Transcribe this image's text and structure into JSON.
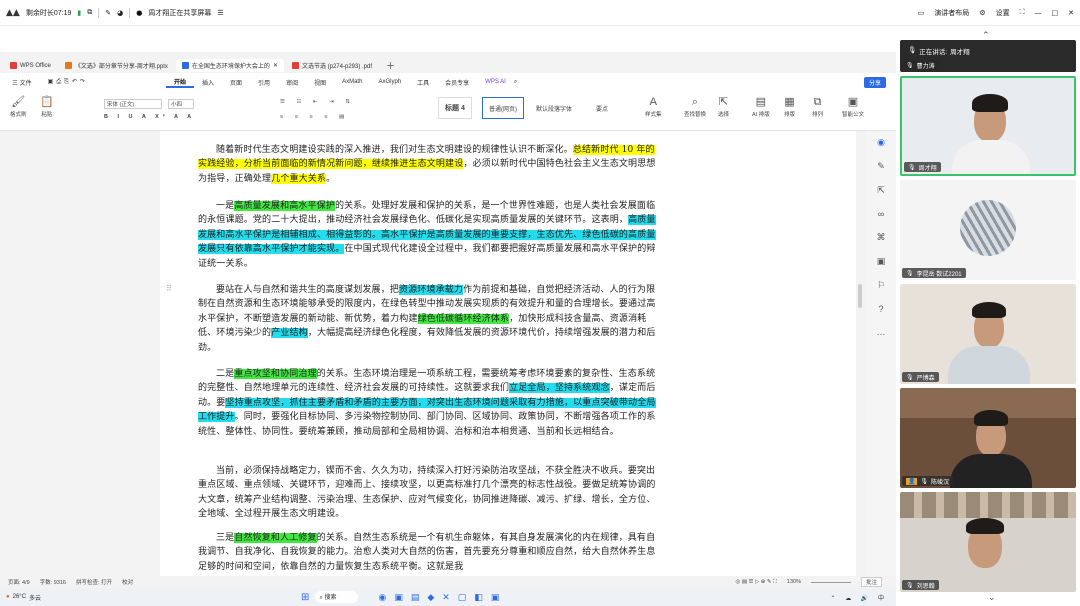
{
  "meeting": {
    "remaining": "剩余时长07:19",
    "sharing_status": "周才翔正在共享屏幕",
    "layout": "演讲者布局",
    "settings": "设置"
  },
  "speaker": {
    "label": "正在讲话:",
    "name": "周才翔"
  },
  "participants": [
    {
      "name": "曹力涛"
    },
    {
      "name": "周才翔"
    },
    {
      "name": "李昆岳 数试2201"
    },
    {
      "name": "严博森"
    },
    {
      "name": "陈峻汉"
    },
    {
      "name": "刘思翰"
    }
  ],
  "wps": {
    "tabs": [
      {
        "label": "WPS Office",
        "color": "#e23d3d"
      },
      {
        "label": "《文选》部分章节分享-周才翔.pptx",
        "color": "#e8761e"
      },
      {
        "label": "在全国生态环境保护大会上的",
        "color": "#2d6be5"
      },
      {
        "label": "文选节选 (p274-p293) .pdf",
        "color": "#e23d3d"
      }
    ],
    "menu": [
      "三 文件",
      "开始",
      "插入",
      "页面",
      "引用",
      "审阅",
      "视图",
      "AxMath",
      "AxGlyph",
      "工具",
      "会员专享",
      "WPS AI"
    ],
    "share": "分享",
    "ribbon": {
      "format_painter": "格式刷",
      "paste": "粘贴",
      "font": "宋体 (正文)",
      "size": "小四",
      "style_heading4": "标题 4",
      "style_normal": "普通(网页)",
      "style_default": "默认段落字体",
      "style_emphasis": "要点",
      "styles_set": "样式集",
      "find_replace": "查找替换",
      "select": "选择",
      "ai_layout": "AI 排版",
      "layout": "排版",
      "arrange": "排列",
      "smart_doc": "智能公文"
    },
    "paragraphs": [
      [
        [
          "随着新时代生态文明建设实践的深入推进，我们对生态文明建设的规律性认识不断深化。",
          ""
        ],
        [
          "总结新时代 10 年的实践经验，分析当前面临的新情况新问题，继续推进生态文明建设",
          ""
        ],
        [
          "，必须以新时代中国特色社会主义生态文明思想为指导，正确处理",
          ""
        ],
        [
          "几个重大关系",
          ""
        ],
        [
          "。",
          ""
        ]
      ],
      [
        [
          "一是",
          ""
        ],
        [
          "高质量发展和高水平保护",
          ""
        ],
        [
          "的关系。处理好发展和保护的关系，是一个世界性难题，也是人类社会发展面临的永恒课题。党的二十大提出，推动经济社会发展绿色化、低碳化是实现高质量发展的关键环节。这表明，",
          ""
        ],
        [
          "高质量发展和高水平保护是相辅相成、相得益彰的。高水平保护是高质量发展的重要支撑，生态优先、绿色低碳的高质量发展只有依靠高水平保护才能实现。",
          ""
        ],
        [
          "在中国式现代化建设全过程中，我们都要把握好高质量发展和高水平保护的辩证统一关系。",
          ""
        ]
      ],
      [
        [
          "要站在人与自然和谐共生的高度谋划发展，把",
          ""
        ],
        [
          "资源环境承载力",
          ""
        ],
        [
          "作为前提和基础，自觉把经济活动、人的行为限制在自然资源和生态环境能够承受的限度内，在绿色转型中推动发展实现质的有效提升和量的合理增长。要通过高水平保护，不断塑造发展的新动能、新优势，着力构建",
          ""
        ],
        [
          "绿色低碳循环经济体系",
          ""
        ],
        [
          "，加快形成科技含量高、资源消耗低、环境污染少的",
          ""
        ],
        [
          "产业结构",
          ""
        ],
        [
          "，大幅提高经济绿色化程度，有效降低发展的资源环境代价，持续增强发展的潜力和后劲。",
          ""
        ]
      ],
      [
        [
          "二是",
          ""
        ],
        [
          "重点攻坚和协同治理",
          ""
        ],
        [
          "的关系。生态环境治理是一项系统工程，需要统筹考虑环境要素的复杂性、生态系统的完整性、自然地理单元的连续性、经济社会发展的可持续性。这就要求我们",
          ""
        ],
        [
          "立足全局，坚持系统观念",
          ""
        ],
        [
          "，谋定而后动。要",
          ""
        ],
        [
          "坚持重点攻坚，抓住主要矛盾和矛盾的主要方面，对突出生态环境问题采取有力措施，以重点突破带动全局工作提升",
          ""
        ],
        [
          "。同时，要强化目标协同、多污染物控制协同、部门协同、区域协同、政策协同，不断增强各项工作的系统性、整体性、协同性。要统筹兼顾，推动局部和全局相协调、治标和治本相贯通、当前和长远相结合。",
          ""
        ]
      ],
      [
        [
          "当前，必须保持战略定力，锲而不舍、久久为功，持续深入打好污染防治攻坚战，不获全胜决不收兵。要突出重点区域、重点领域、关键环节，迎难而上、接续攻坚，以更高标准打几个漂亮的标志性战役。要做足统筹协调的大文章，统筹产业结构调整、污染治理、生态保护、应对气候变化，协同推进降碳、减污、扩绿、增长，全方位、全地域、全过程开展生态文明建设。",
          ""
        ]
      ],
      [
        [
          "三是",
          ""
        ],
        [
          "自然恢复和人工修复",
          ""
        ],
        [
          "的关系。自然生态系统是一个有机生命躯体，有其自身发展演化的内在规律，具有自我调节、自我净化、自我恢复的能力。治愈人类对大自然的伤害，首先要充分尊重和顺应自然，给大自然休养生息足够的时间和空间，依靠自然的力量恢复生态系统平衡。这就是我",
          ""
        ]
      ]
    ],
    "status": {
      "page": "页面: 4/9",
      "words": "字数: 9316",
      "spell": "拼写检查: 打开",
      "proof": "校对",
      "zoom": "130%",
      "comment": "批注"
    },
    "taskbar": {
      "temp": "26°C",
      "weather": "多云",
      "search": "搜索"
    }
  }
}
